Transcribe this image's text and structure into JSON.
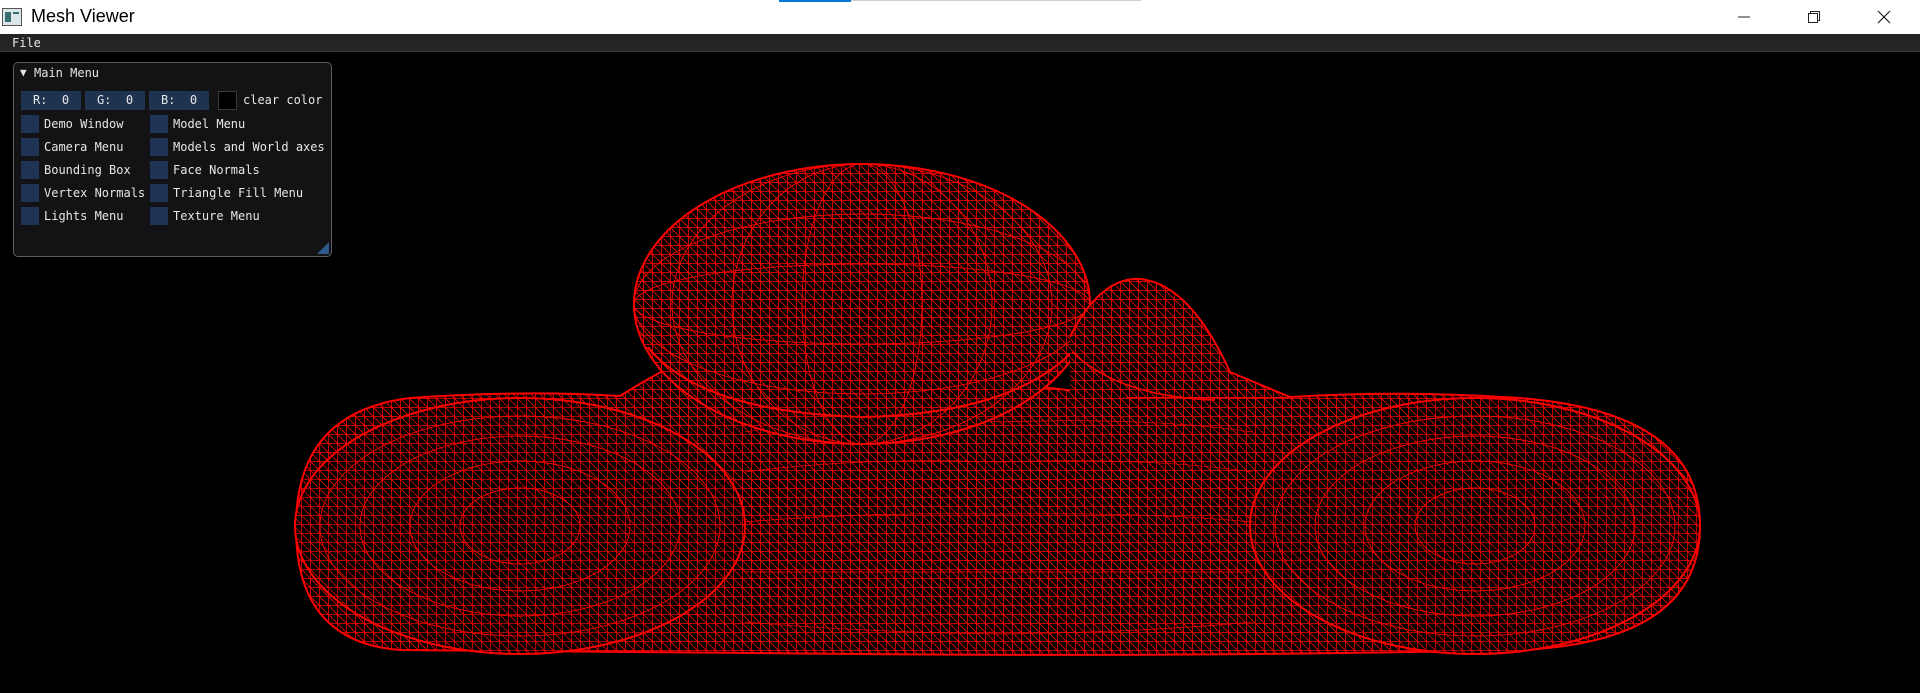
{
  "window": {
    "title": "Mesh Viewer",
    "icon": "app-icon"
  },
  "titlebar_buttons": [
    {
      "name": "minimize",
      "icon": "minimize-icon"
    },
    {
      "name": "restore",
      "icon": "restore-icon"
    },
    {
      "name": "close",
      "icon": "close-icon"
    }
  ],
  "menubar": {
    "file_label": "File"
  },
  "panel": {
    "title": "Main Menu",
    "collapse_icon": "triangle-down-icon",
    "color": {
      "r_label": "R:  0",
      "g_label": "G:  0",
      "b_label": "B:  0",
      "swatch_hex": "#000000",
      "label": "clear color"
    },
    "checkboxes_left": [
      "Demo Window",
      "Camera Menu",
      "Bounding Box",
      "Vertex Normals",
      "Lights Menu"
    ],
    "checkboxes_right": [
      "Model Menu",
      "Models and World axes",
      "Face Normals",
      "Triangle Fill Menu",
      "Texture Menu"
    ]
  },
  "mesh": {
    "render_mode": "wireframe",
    "line_color": "#ff0000",
    "background_color": "#000000"
  }
}
